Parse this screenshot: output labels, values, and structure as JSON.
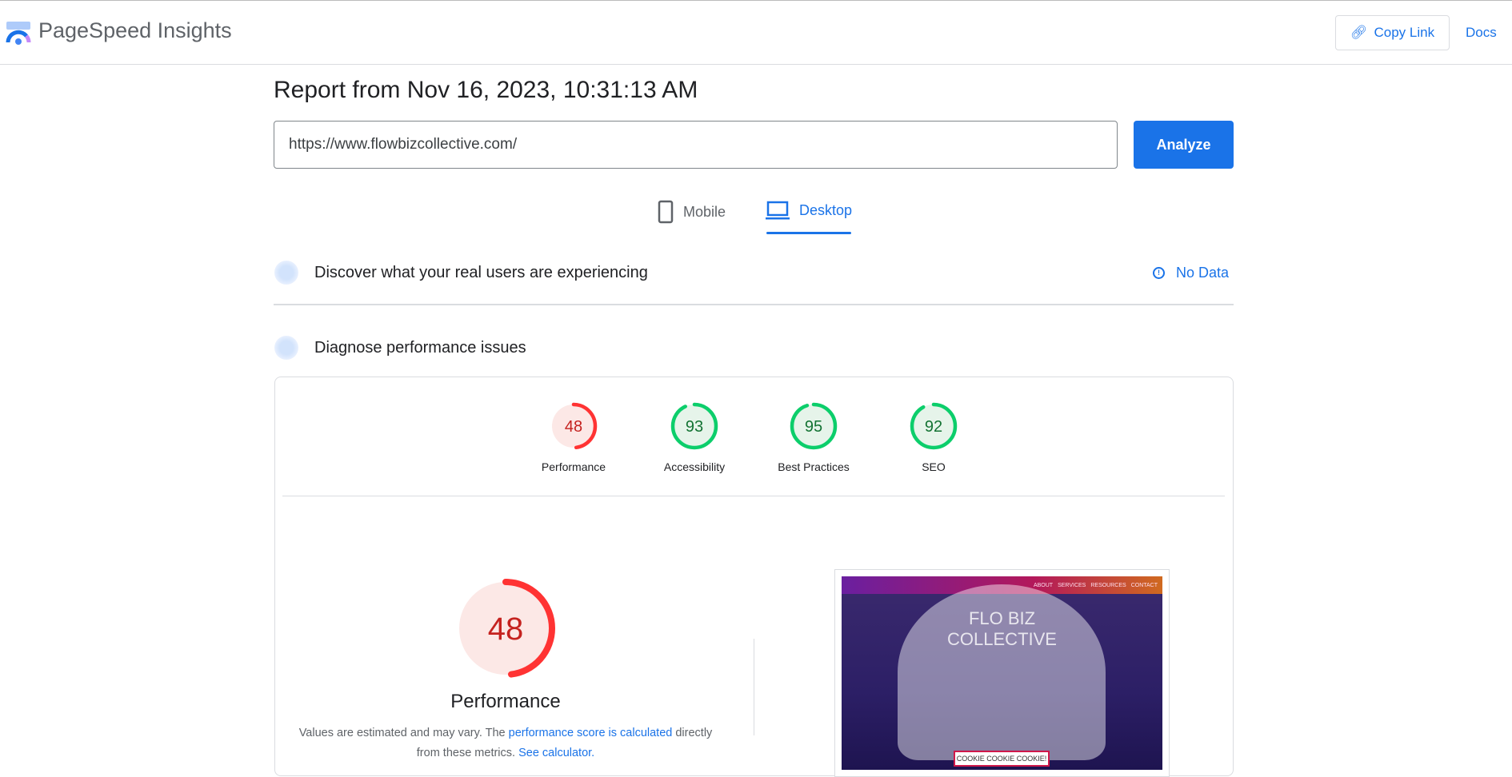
{
  "header": {
    "app_name": "PageSpeed Insights",
    "copy_link": "Copy Link",
    "docs": "Docs"
  },
  "report": {
    "title": "Report from Nov 16, 2023, 10:31:13 AM",
    "url": "https://www.flowbizcollective.com/",
    "analyze": "Analyze"
  },
  "tabs": [
    {
      "label": "Mobile",
      "active": false
    },
    {
      "label": "Desktop",
      "active": true
    }
  ],
  "field_data": {
    "title": "Discover what your real users are experiencing",
    "status": "No Data"
  },
  "lab": {
    "title": "Diagnose performance issues"
  },
  "scores": [
    {
      "label": "Performance",
      "value": 48,
      "color": "#ff3333",
      "bg": "#fce8e6",
      "text": "#c5221f"
    },
    {
      "label": "Accessibility",
      "value": 93,
      "color": "#0cce6b",
      "bg": "#e6f4ea",
      "text": "#137333"
    },
    {
      "label": "Best Practices",
      "value": 95,
      "color": "#0cce6b",
      "bg": "#e6f4ea",
      "text": "#137333"
    },
    {
      "label": "SEO",
      "value": 92,
      "color": "#0cce6b",
      "bg": "#e6f4ea",
      "text": "#137333"
    }
  ],
  "performance": {
    "value": 48,
    "title": "Performance",
    "desc_1": "Values are estimated and may vary. The ",
    "link_1": "performance score is calculated",
    "desc_2": " directly from these metrics. ",
    "link_2": "See calculator."
  },
  "screenshot": {
    "nav": [
      "ABOUT",
      "SERVICES",
      "RESOURCES",
      "CONTACT"
    ],
    "title_1": "FLO   BIZ",
    "title_2": "COLLECTIVE",
    "cookie": "COOKIE COOKIE COOKIE!"
  }
}
